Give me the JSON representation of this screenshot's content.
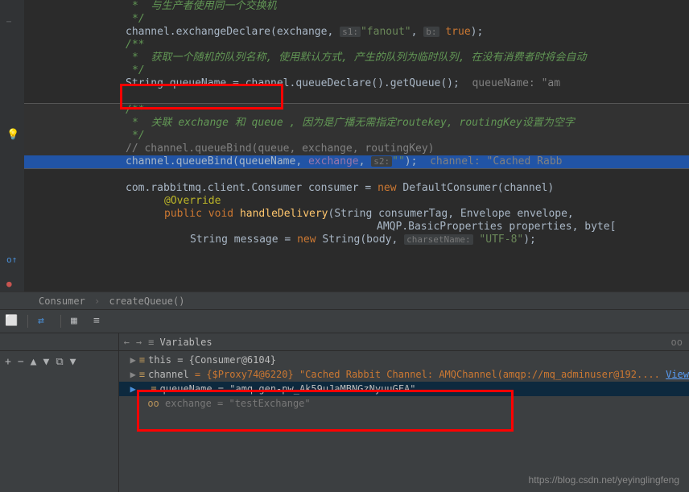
{
  "code": {
    "l1": "*  与生产者使用同一个交换机",
    "l2": "*/",
    "l3a": "channel.exchangeDeclare(exchange, ",
    "l3h1": "s1:",
    "l3b": "\"fanout\"",
    "l3c": ", ",
    "l3h2": "b:",
    "l3d": " true",
    "l3e": ");",
    "l4": "/**",
    "l5": "*  获取一个随机的队列名称, 使用默认方式, 产生的队列为临时队列, 在没有消费者时将会自动",
    "l6": "*/",
    "l7a": "String queueName = ",
    "l7b": "channel.queueDeclare().getQueue();",
    "l7c": "  queueName: \"am",
    "l8": "/**",
    "l9a": "*  关联 ",
    "l9b": "exchange",
    "l9c": " 和 ",
    "l9d": "queue",
    "l9e": " , 因为是广播无需指定",
    "l9f": "routekey",
    "l9g": ", ",
    "l9h": "routingKey",
    "l9i": "设置为空字",
    "l10": "*/",
    "l11": "// channel.queueBind(queue, exchange, routingKey)",
    "l12a": "channel.queueBind(queueName, ",
    "l12b": "exchange",
    "l12c": ", ",
    "l12h": "s2:",
    "l12d": "\"\"",
    "l12e": ");",
    "l12f": "  channel: \"Cached Rabb",
    "l13a": "com.rabbitmq.client.Consumer consumer = ",
    "l13b": "new",
    "l13c": " DefaultConsumer(channel) ",
    "l14": "@Override",
    "l15a": "public",
    "l15b": " void ",
    "l15c": "handleDelivery",
    "l15d": "(String consumerTag, Envelope envelope,",
    "l16": "AMQP.BasicProperties properties, byte[",
    "l17a": "String message = ",
    "l17b": "new",
    "l17c": " String(body, ",
    "l17h": "charsetName:",
    "l17d": " \"UTF-8\"",
    "l17e": ");"
  },
  "breadcrumb": {
    "a": "Consumer",
    "b": "createQueue()"
  },
  "varsHeader": "Variables",
  "ooHeader": "oo",
  "vars": {
    "this": "this = {Consumer@6104}",
    "channel_a": "channel",
    "channel_b": " = {$Proxy74@6220} \"Cached Rabbit Channel: AMQChannel(amqp://mq_adminuser@192.... ",
    "channel_link": "View",
    "queueName": "queueName = \"amq.gen-pw_Ak59uJaMBNGzNyuuGFA\"",
    "exchange": "exchange = \"testExchange\""
  },
  "watermark": "https://blog.csdn.net/yeyinglingfeng"
}
